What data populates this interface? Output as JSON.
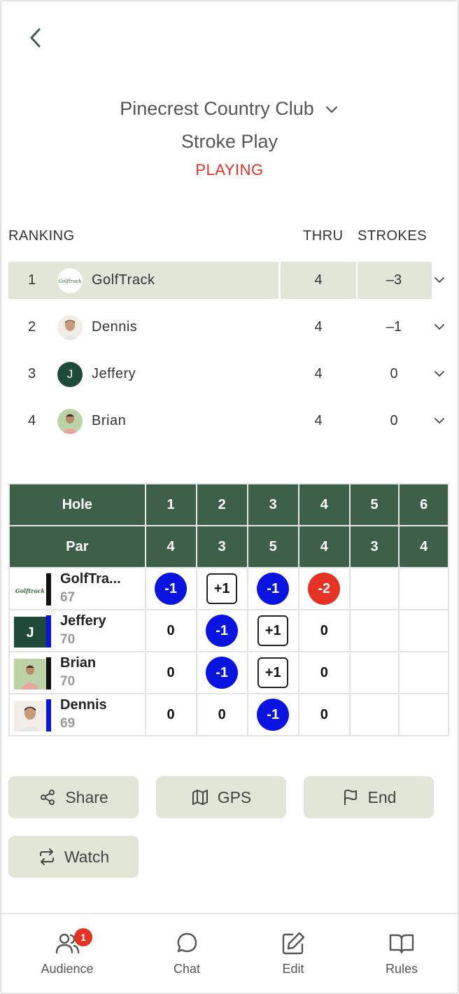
{
  "header": {
    "club": "Pinecrest Country Club",
    "mode": "Stroke Play",
    "status": "PLAYING"
  },
  "ranking": {
    "columns": {
      "ranking": "RANKING",
      "thru": "THRU",
      "strokes": "STROKES"
    },
    "rows": [
      {
        "pos": "1",
        "name": "GolfTrack",
        "thru": "4",
        "strokes": "–3",
        "avatar": "golftrack-logo"
      },
      {
        "pos": "2",
        "name": "Dennis",
        "thru": "4",
        "strokes": "–1",
        "avatar": "photo"
      },
      {
        "pos": "3",
        "name": "Jeffery",
        "thru": "4",
        "strokes": "0",
        "avatar": "initial",
        "initial": "J"
      },
      {
        "pos": "4",
        "name": "Brian",
        "thru": "4",
        "strokes": "0",
        "avatar": "photo"
      }
    ]
  },
  "scorecard": {
    "hole_label": "Hole",
    "par_label": "Par",
    "holes": [
      "1",
      "2",
      "3",
      "4",
      "5",
      "6"
    ],
    "pars": [
      "4",
      "3",
      "5",
      "4",
      "3",
      "4"
    ],
    "players": [
      {
        "name": "GolfTra...",
        "handicap": "67",
        "bar_color": "#111111",
        "avatar_logo": "Golftrack",
        "scores": [
          "-1",
          "+1",
          "-1",
          "-2",
          "",
          ""
        ],
        "styles": [
          "blue",
          "box",
          "blue",
          "red",
          "",
          ""
        ]
      },
      {
        "name": "Jeffery",
        "handicap": "70",
        "bar_color": "#0a14e0",
        "avatar_initial": "J",
        "scores": [
          "0",
          "-1",
          "+1",
          "0",
          "",
          ""
        ],
        "styles": [
          "",
          "blue",
          "box",
          "",
          "",
          ""
        ]
      },
      {
        "name": "Brian",
        "handicap": "70",
        "bar_color": "#111111",
        "scores": [
          "0",
          "-1",
          "+1",
          "0",
          "",
          ""
        ],
        "styles": [
          "",
          "blue",
          "box",
          "",
          "",
          ""
        ]
      },
      {
        "name": "Dennis",
        "handicap": "69",
        "bar_color": "#0a14e0",
        "scores": [
          "0",
          "0",
          "-1",
          "0",
          "",
          ""
        ],
        "styles": [
          "",
          "",
          "blue",
          "",
          "",
          ""
        ]
      }
    ]
  },
  "actions": {
    "share": "Share",
    "gps": "GPS",
    "end": "End",
    "watch": "Watch"
  },
  "tabs": {
    "audience": "Audience",
    "audience_badge": "1",
    "chat": "Chat",
    "edit": "Edit",
    "rules": "Rules"
  },
  "colors": {
    "accent": "#3f6048",
    "highlight": "#e2e6d6",
    "red": "#e53224",
    "blue": "#0a14e0"
  }
}
